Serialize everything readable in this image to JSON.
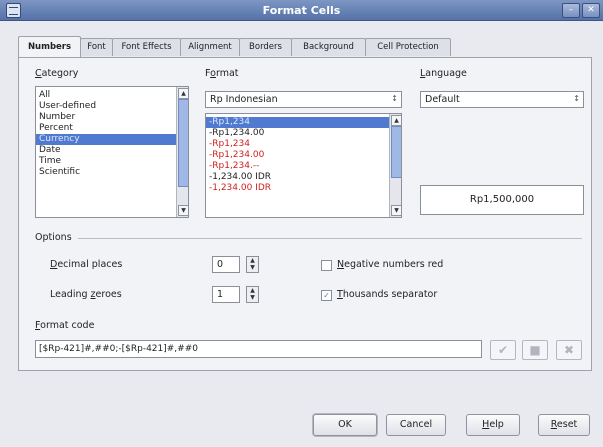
{
  "window": {
    "title": "Format Cells",
    "minimize_glyph": "–",
    "close_glyph": "✕"
  },
  "tabs": [
    "Numbers",
    "Font",
    "Font Effects",
    "Alignment",
    "Borders",
    "Background",
    "Cell Protection"
  ],
  "active_tab": "Numbers",
  "category": {
    "label_ul": "C",
    "label_rest": "ategory",
    "items": [
      "All",
      "User-defined",
      "Number",
      "Percent",
      "Currency",
      "Date",
      "Time",
      "Scientific"
    ],
    "selected": "Currency"
  },
  "format": {
    "label_pre": "F",
    "label_ul": "o",
    "label_rest": "rmat",
    "currency_value": "Rp Indonesian",
    "items": [
      {
        "text": "-Rp1,234",
        "red": false,
        "selected": true
      },
      {
        "text": "-Rp1,234.00",
        "red": false,
        "selected": false
      },
      {
        "text": "-Rp1,234",
        "red": true,
        "selected": false
      },
      {
        "text": "-Rp1,234.00",
        "red": true,
        "selected": false
      },
      {
        "text": "-Rp1,234.--",
        "red": true,
        "selected": false
      },
      {
        "text": "-1,234.00 IDR",
        "red": false,
        "selected": false
      },
      {
        "text": "-1,234.00 IDR",
        "red": true,
        "selected": false
      }
    ]
  },
  "language": {
    "label_ul": "L",
    "label_rest": "anguage",
    "value": "Default"
  },
  "preview": {
    "text": "Rp1,500,000"
  },
  "options": {
    "heading": "Options",
    "decimal_places": {
      "label_ul": "D",
      "label_rest": "ecimal places",
      "value": "0"
    },
    "leading_zeroes": {
      "label_pre": "Leading ",
      "label_ul": "z",
      "label_rest": "eroes",
      "value": "1"
    },
    "negative_red": {
      "label_ul": "N",
      "label_rest": "egative numbers red",
      "checked": false
    },
    "thousands_sep": {
      "label_ul": "T",
      "label_rest": "housands separator",
      "checked": true
    }
  },
  "format_code": {
    "label_ul": "F",
    "label_rest": "ormat code",
    "value": "[$Rp-421]#,##0;-[$Rp-421]#,##0"
  },
  "buttons": {
    "ok": "OK",
    "cancel": "Cancel",
    "help_ul": "H",
    "help_rest": "elp",
    "reset_ul": "R",
    "reset_rest": "eset"
  },
  "colors": {
    "accent": "#4f7ad0",
    "negative": "#d0201c",
    "titlebar": "#6a84b8"
  }
}
